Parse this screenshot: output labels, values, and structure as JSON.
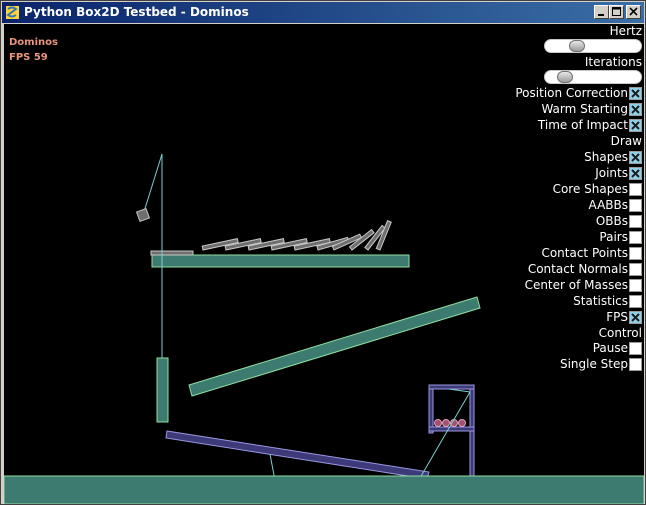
{
  "window": {
    "title": "Python Box2D Testbed - Dominos",
    "icon": "python-snake-icon",
    "buttons": [
      "minimize-icon",
      "maximize-icon",
      "close-icon"
    ]
  },
  "overlay": {
    "test_name": "Dominos",
    "fps": "FPS 59"
  },
  "controls": {
    "hertz_label": "Hertz",
    "hertz_level": 0.3,
    "iterations_label": "Iterations",
    "iterations_level": 0.15,
    "options": [
      {
        "label": "Position Correction",
        "checked": true
      },
      {
        "label": "Warm Starting",
        "checked": true
      },
      {
        "label": "Time of Impact",
        "checked": true
      }
    ],
    "draw_header": "Draw",
    "draw_options": [
      {
        "label": "Shapes",
        "checked": true
      },
      {
        "label": "Joints",
        "checked": true
      },
      {
        "label": "Core Shapes",
        "checked": false
      },
      {
        "label": "AABBs",
        "checked": false
      },
      {
        "label": "OBBs",
        "checked": false
      },
      {
        "label": "Pairs",
        "checked": false
      },
      {
        "label": "Contact Points",
        "checked": false
      },
      {
        "label": "Contact Normals",
        "checked": false
      },
      {
        "label": "Center of Masses",
        "checked": false
      },
      {
        "label": "Statistics",
        "checked": false
      },
      {
        "label": "FPS",
        "checked": true
      }
    ],
    "control_header": "Control",
    "control_options": [
      {
        "label": "Pause",
        "checked": false
      },
      {
        "label": "Single Step",
        "checked": false
      }
    ]
  },
  "colors": {
    "title_start": "#0a246a",
    "title_end": "#3a6ea5",
    "static_body": "#3d7a70",
    "static_outline": "#8fe0a0",
    "joint_line": "#7ad0d0",
    "dynamic_outline": "#c8c8c8",
    "dynamic_fill": "#6e6e6e",
    "seesaw_fill": "#3c3a78",
    "seesaw_outline": "#9a98e0",
    "checkbox_checked": "#8fd0e8",
    "overlay_text": "#e8967c"
  }
}
